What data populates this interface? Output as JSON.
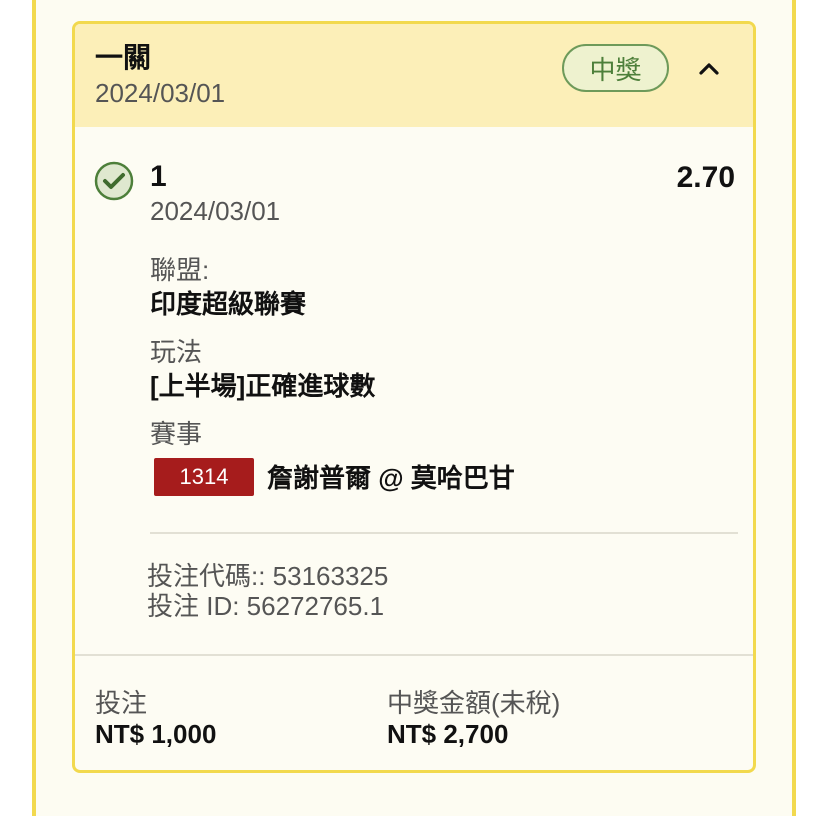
{
  "ticket": {
    "bet_type": "一關",
    "date": "2024/03/01",
    "status": "中獎"
  },
  "selection": {
    "name": "1",
    "date": "2024/03/01",
    "odds": "2.70",
    "league_label": "聯盟:",
    "league_value": "印度超級聯賽",
    "market_label": "玩法",
    "market_value": "[上半場]正確進球數",
    "event_label": "賽事",
    "event_id": "1314",
    "event_name": "詹謝普爾 @ 莫哈巴甘"
  },
  "meta": {
    "bet_code": "投注代碼:: 53163325",
    "bet_id": "投注 ID: 56272765.1"
  },
  "footer": {
    "stake_label": "投注",
    "stake_value": "NT$ 1,000",
    "payout_label": "中獎金額(未稅)",
    "payout_value": "NT$ 2,700"
  },
  "colors": {
    "accent_border": "#f2d94e",
    "header_bg": "#fcefb8",
    "win_green": "#4d7f3a",
    "event_red": "#a61c1c"
  },
  "icons": {
    "status": "check-circle-icon",
    "collapse": "chevron-up-icon"
  }
}
